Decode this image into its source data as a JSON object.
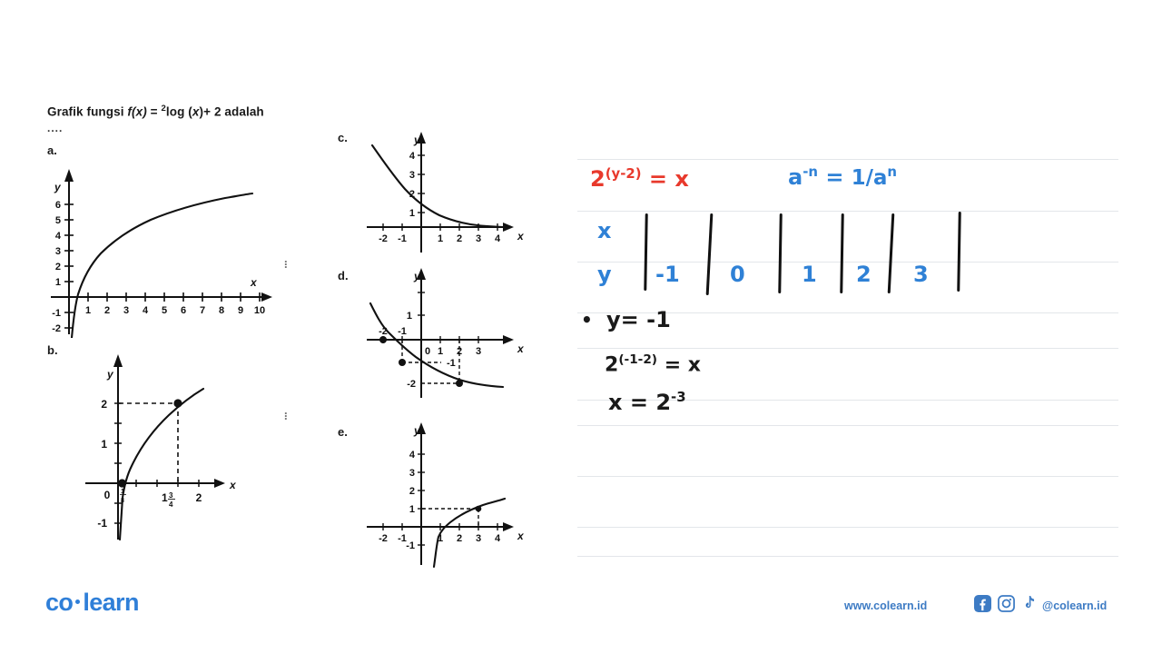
{
  "question": {
    "prefix": "Grafik fungsi ",
    "fn": "f(x)",
    "eq": " = ",
    "base": "2",
    "log": "log (",
    "var": "x",
    "tail": ")+ 2 adalah",
    "dots": "...."
  },
  "options": [
    {
      "key": "a.",
      "label": "a."
    },
    {
      "key": "b.",
      "label": "b."
    },
    {
      "key": "c.",
      "label": "c."
    },
    {
      "key": "d.",
      "label": "d."
    },
    {
      "key": "e.",
      "label": "e."
    }
  ],
  "graph_a": {
    "axis_x_label": "x",
    "axis_y_label": "y",
    "x_ticks": [
      "1",
      "2",
      "3",
      "4",
      "5",
      "6",
      "7",
      "8",
      "9",
      "10"
    ],
    "y_ticks": [
      "6",
      "5",
      "4",
      "3",
      "2",
      "1",
      "-1",
      "-2"
    ]
  },
  "graph_b": {
    "axis_x_label": "x",
    "axis_y_label": "y",
    "origin_label": "0",
    "x_ticks": [
      "1¾",
      "2"
    ],
    "x_small_frac_num": "1",
    "x_small_frac_den": "8",
    "y_ticks": [
      "2",
      "1",
      "-1"
    ],
    "points": [
      "(1/8, 0)",
      "(1¾, 2)"
    ]
  },
  "graph_c": {
    "axis_x_label": "x",
    "axis_y_label": "y",
    "x_ticks": [
      "-2",
      "-1",
      "1",
      "2",
      "3",
      "4"
    ],
    "y_ticks": [
      "4",
      "3",
      "2",
      "1"
    ]
  },
  "graph_d": {
    "axis_x_label": "x",
    "axis_y_label": "y",
    "origin_label": "0",
    "x_ticks": [
      "1",
      "2",
      "3"
    ],
    "x_neg_ticks": [
      "-2",
      "-1"
    ],
    "y_ticks": [
      "1",
      "-1",
      "-2"
    ],
    "points": [
      "(-2, 0)",
      "(-1, -1)",
      "(2, -2)"
    ]
  },
  "graph_e": {
    "axis_x_label": "x",
    "axis_y_label": "y",
    "x_ticks": [
      "-2",
      "-1",
      "1",
      "2",
      "3",
      "4"
    ],
    "y_ticks": [
      "4",
      "3",
      "2",
      "1",
      "-1"
    ],
    "points": [
      "(1, 0)",
      "(3, 1)"
    ]
  },
  "notes": {
    "line1_red_base": "2",
    "line1_red_exp": "(y-2)",
    "line1_red_rest": " = x",
    "line1_blue_a": "a",
    "line1_blue_exp": "-n",
    "line1_blue_rest": " = ",
    "line1_blue_frac": "1/a",
    "line1_blue_frac_exp": "n",
    "table_row_x": "x",
    "table_row_y": "y",
    "table_y_values": [
      "-1",
      "0",
      "1",
      "2",
      "3"
    ],
    "bullet": "•",
    "line_y_eq": "y= -1",
    "line_sub_base": "2",
    "line_sub_exp": "(-1-2)",
    "line_sub_rest": " = x",
    "line_res_lhs": "x = ",
    "line_res_base": "2",
    "line_res_exp": "-3"
  },
  "footer": {
    "logo_left": "co",
    "logo_right": "learn",
    "website": "www.colearn.id",
    "handle": "@colearn.id",
    "social_icons": [
      "facebook-icon",
      "instagram-icon",
      "tiktok-icon"
    ]
  },
  "colors": {
    "brand_blue": "#2f7fd8",
    "hand_red": "#e8392c",
    "hand_blue": "#2f81d6",
    "rule_gray": "#e3e6ea"
  }
}
